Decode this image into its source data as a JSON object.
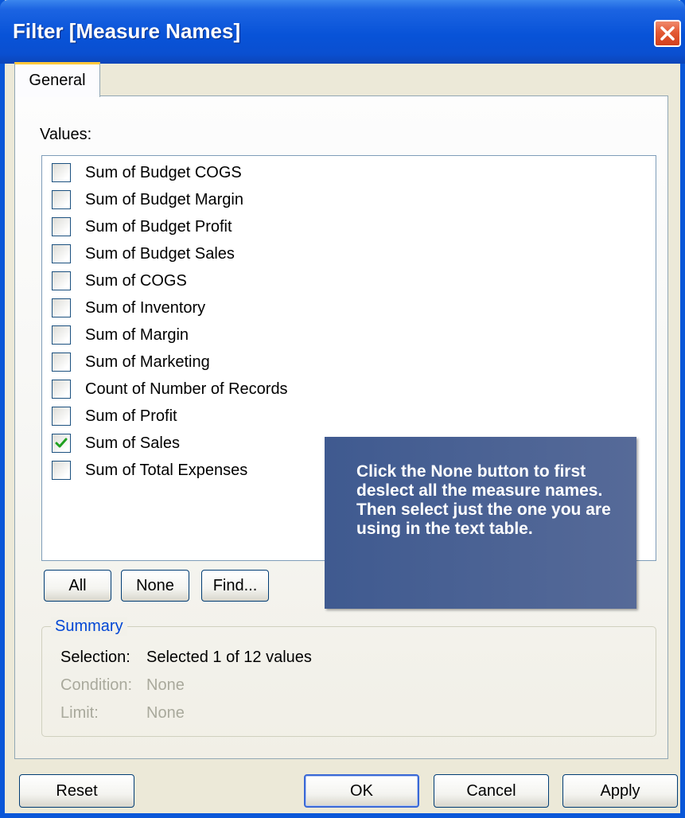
{
  "window": {
    "title": "Filter [Measure Names]",
    "close_icon": "close-x-icon"
  },
  "tabs": [
    {
      "label": "General",
      "active": true
    }
  ],
  "values_label": "Values:",
  "values_list": [
    {
      "label": "Sum of Budget COGS",
      "checked": false
    },
    {
      "label": "Sum of Budget Margin",
      "checked": false
    },
    {
      "label": "Sum of Budget Profit",
      "checked": false
    },
    {
      "label": "Sum of Budget Sales",
      "checked": false
    },
    {
      "label": "Sum of COGS",
      "checked": false
    },
    {
      "label": "Sum of Inventory",
      "checked": false
    },
    {
      "label": "Sum of Margin",
      "checked": false
    },
    {
      "label": "Sum of Marketing",
      "checked": false
    },
    {
      "label": "Count of Number of Records",
      "checked": false
    },
    {
      "label": "Sum of Profit",
      "checked": false
    },
    {
      "label": "Sum of Sales",
      "checked": true
    },
    {
      "label": "Sum of Total Expenses",
      "checked": false
    }
  ],
  "list_buttons": {
    "all": "All",
    "none": "None",
    "find": "Find..."
  },
  "summary": {
    "legend": "Summary",
    "selection_label": "Selection:",
    "selection_value": "Selected 1 of 12 values",
    "condition_label": "Condition:",
    "condition_value": "None",
    "limit_label": "Limit:",
    "limit_value": "None"
  },
  "tooltip": {
    "text": "Click the None button to first deslect all the measure names. Then select just the one you are using in the text table."
  },
  "footer_buttons": {
    "reset": "Reset",
    "ok": "OK",
    "cancel": "Cancel",
    "apply": "Apply"
  },
  "colors": {
    "titlebar": "#0853d8",
    "close_button": "#e35a35",
    "tab_highlight": "#ffc83c",
    "checkmark": "#21a121",
    "tooltip_bg": "#4a6294",
    "summary_legend": "#0046d5",
    "dim_text": "#a9a99c"
  }
}
